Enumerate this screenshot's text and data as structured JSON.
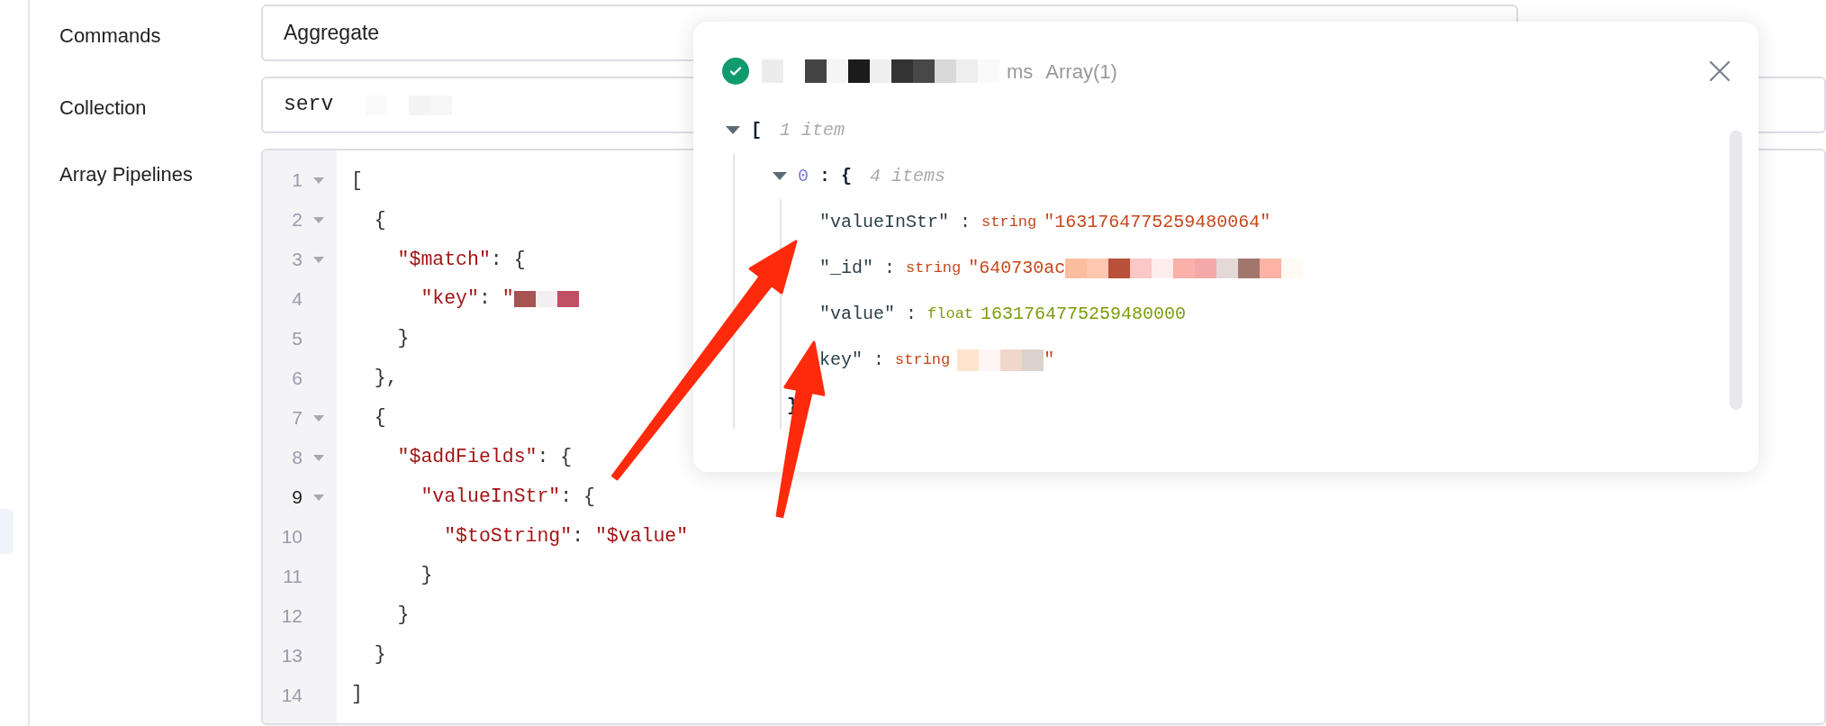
{
  "form": {
    "fields": [
      {
        "label": "Commands",
        "kind": "select",
        "value": "Aggregate",
        "redacted": false
      },
      {
        "label": "Collection",
        "kind": "text",
        "value": "serv",
        "redacted": true
      },
      {
        "label": "Array Pipelines",
        "kind": "code"
      }
    ]
  },
  "editor": {
    "lines": [
      {
        "number": "1",
        "foldable": true,
        "current": false,
        "tokens": [
          {
            "kind": "punct",
            "text": "["
          }
        ]
      },
      {
        "number": "2",
        "foldable": true,
        "current": false,
        "tokens": [
          {
            "kind": "punct",
            "text": "  {"
          }
        ]
      },
      {
        "number": "3",
        "foldable": true,
        "current": false,
        "tokens": [
          {
            "kind": "string",
            "text": "    \"$match\""
          },
          {
            "kind": "punct",
            "text": ": {"
          }
        ]
      },
      {
        "number": "4",
        "foldable": false,
        "current": false,
        "tokens": [
          {
            "kind": "string",
            "text": "      \"key\""
          },
          {
            "kind": "punct",
            "text": ": "
          },
          {
            "kind": "string",
            "text": "\""
          },
          {
            "kind": "redacted"
          }
        ]
      },
      {
        "number": "5",
        "foldable": false,
        "current": false,
        "tokens": [
          {
            "kind": "punct",
            "text": "    }"
          }
        ]
      },
      {
        "number": "6",
        "foldable": false,
        "current": false,
        "tokens": [
          {
            "kind": "punct",
            "text": "  },"
          }
        ]
      },
      {
        "number": "7",
        "foldable": true,
        "current": false,
        "tokens": [
          {
            "kind": "punct",
            "text": "  {"
          }
        ]
      },
      {
        "number": "8",
        "foldable": true,
        "current": false,
        "tokens": [
          {
            "kind": "string",
            "text": "    \"$addFields\""
          },
          {
            "kind": "punct",
            "text": ": {"
          }
        ]
      },
      {
        "number": "9",
        "foldable": true,
        "current": true,
        "tokens": [
          {
            "kind": "string",
            "text": "      \"valueInStr\""
          },
          {
            "kind": "punct",
            "text": ": {"
          }
        ]
      },
      {
        "number": "10",
        "foldable": false,
        "current": false,
        "tokens": [
          {
            "kind": "string",
            "text": "        \"$toString\""
          },
          {
            "kind": "punct",
            "text": ": "
          },
          {
            "kind": "string",
            "text": "\"$value\""
          }
        ]
      },
      {
        "number": "11",
        "foldable": false,
        "current": false,
        "tokens": [
          {
            "kind": "punct",
            "text": "      }"
          }
        ]
      },
      {
        "number": "12",
        "foldable": false,
        "current": false,
        "tokens": [
          {
            "kind": "punct",
            "text": "    }"
          }
        ]
      },
      {
        "number": "13",
        "foldable": false,
        "current": false,
        "tokens": [
          {
            "kind": "punct",
            "text": "  }"
          }
        ]
      },
      {
        "number": "14",
        "foldable": false,
        "current": false,
        "tokens": [
          {
            "kind": "punct",
            "text": "]"
          }
        ]
      }
    ]
  },
  "result_popup": {
    "title": {
      "redacted": true,
      "unit": "ms",
      "summary": "Array(1)"
    },
    "tree": {
      "expanded": true,
      "bracket": "[",
      "count": "1 item",
      "children": [
        {
          "key": "0",
          "colon": ":",
          "expanded": true,
          "bracket": "{",
          "count": "4 items",
          "close": "}",
          "children": [
            {
              "key": "\"valueInStr\"",
              "colon": ":",
              "type": "string",
              "value": "\"1631764775259480064\"",
              "kind": "plain"
            },
            {
              "key": "\"_id\"",
              "colon": ":",
              "type": "string",
              "value": "\"640730ac",
              "kind": "tailmasked"
            },
            {
              "key": "\"value\"",
              "colon": ":",
              "type": "float",
              "value": "1631764775259480000",
              "kind": "plain"
            },
            {
              "key": "key\"",
              "colon": ":",
              "type": "string",
              "value": "\"",
              "kind": "headmasked"
            }
          ]
        }
      ]
    }
  }
}
